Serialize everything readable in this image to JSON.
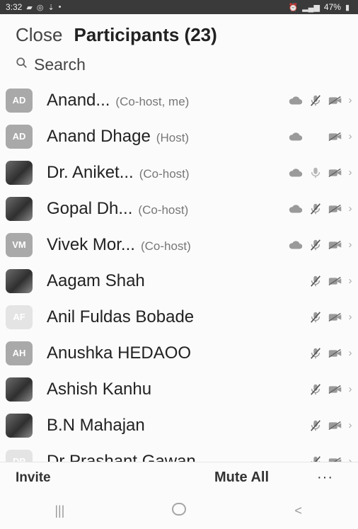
{
  "status_bar": {
    "time": "3:32",
    "battery": "47%",
    "icons_left": [
      "chat-icon",
      "whatsapp-icon",
      "download-icon",
      "dot-icon"
    ],
    "icons_right": [
      "alarm-icon",
      "signal-icon",
      "battery-icon"
    ]
  },
  "header": {
    "close_label": "Close",
    "title": "Participants (23)"
  },
  "search": {
    "placeholder": "Search"
  },
  "participants": [
    {
      "initials": "AD",
      "name": "Anand...",
      "role": "(Co-host, me)",
      "avatar": "initials",
      "cloud": true,
      "mic": "muted",
      "video": "off"
    },
    {
      "initials": "AD",
      "name": "Anand Dhage",
      "role": "(Host)",
      "avatar": "initials",
      "cloud": true,
      "mic": "none",
      "video": "off"
    },
    {
      "initials": "",
      "name": "Dr. Aniket...",
      "role": "(Co-host)",
      "avatar": "photo",
      "cloud": true,
      "mic": "on",
      "video": "off"
    },
    {
      "initials": "",
      "name": "Gopal Dh...",
      "role": "(Co-host)",
      "avatar": "photo",
      "cloud": true,
      "mic": "muted",
      "video": "off"
    },
    {
      "initials": "VM",
      "name": "Vivek Mor...",
      "role": "(Co-host)",
      "avatar": "initials",
      "cloud": true,
      "mic": "muted",
      "video": "off"
    },
    {
      "initials": "",
      "name": "Aagam Shah",
      "role": "",
      "avatar": "photo",
      "cloud": false,
      "mic": "muted",
      "video": "off"
    },
    {
      "initials": "AF",
      "name": "Anil Fuldas Bobade",
      "role": "",
      "avatar": "light",
      "cloud": false,
      "mic": "muted",
      "video": "off"
    },
    {
      "initials": "AH",
      "name": "Anushka HEDAOO",
      "role": "",
      "avatar": "initials",
      "cloud": false,
      "mic": "muted",
      "video": "off"
    },
    {
      "initials": "",
      "name": "Ashish Kanhu",
      "role": "",
      "avatar": "photo",
      "cloud": false,
      "mic": "muted",
      "video": "off"
    },
    {
      "initials": "",
      "name": "B.N Mahajan",
      "role": "",
      "avatar": "photo",
      "cloud": false,
      "mic": "muted",
      "video": "off"
    },
    {
      "initials": "DP",
      "name": "Dr Prashant Gawan...",
      "role": "",
      "avatar": "light",
      "cloud": false,
      "mic": "muted",
      "video": "off"
    }
  ],
  "footer": {
    "invite_label": "Invite",
    "mute_all_label": "Mute All",
    "more_label": "···"
  },
  "navbar": {
    "recents": "|||",
    "back": "<"
  }
}
